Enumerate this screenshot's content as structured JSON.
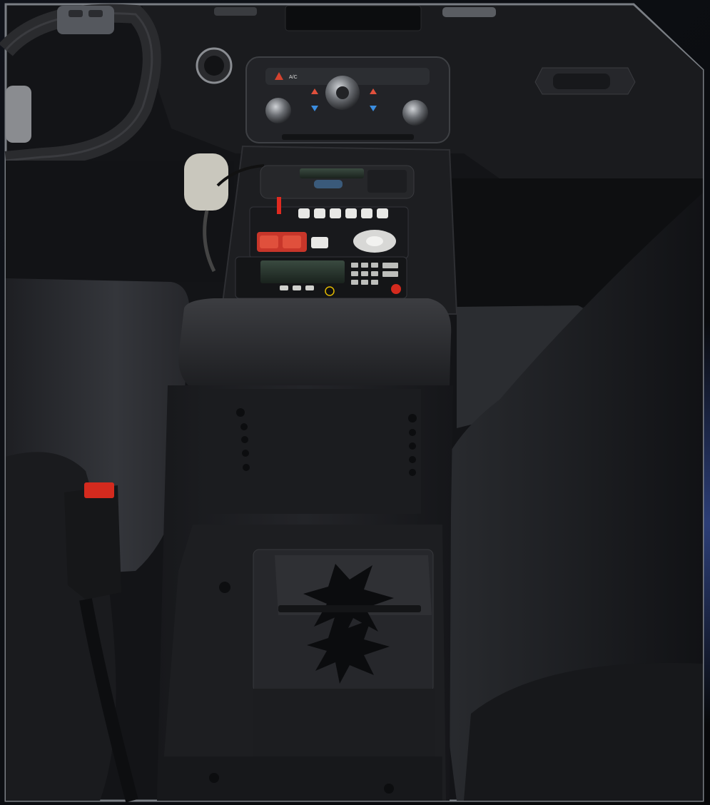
{
  "hvac": {
    "ac_label": "A/C"
  },
  "colors": {
    "background": "#0b0d12",
    "frame": "#6e7278",
    "interior_dark": "#141518",
    "seat_fabric": "#2a2c30",
    "console_metal": "#1c1d20",
    "button_white": "#e8e8e6",
    "button_red": "#e0503c",
    "seatbelt_red": "#d42a1e",
    "accent_glow": "#3b5aa8"
  },
  "icons": [
    "steering-wheel-icon",
    "hazard-icon",
    "fan-knob-icon",
    "temperature-up-icon",
    "temperature-down-icon",
    "seatbelt-buckle-icon",
    "radio-microphone-icon",
    "cup-holder-icon"
  ]
}
